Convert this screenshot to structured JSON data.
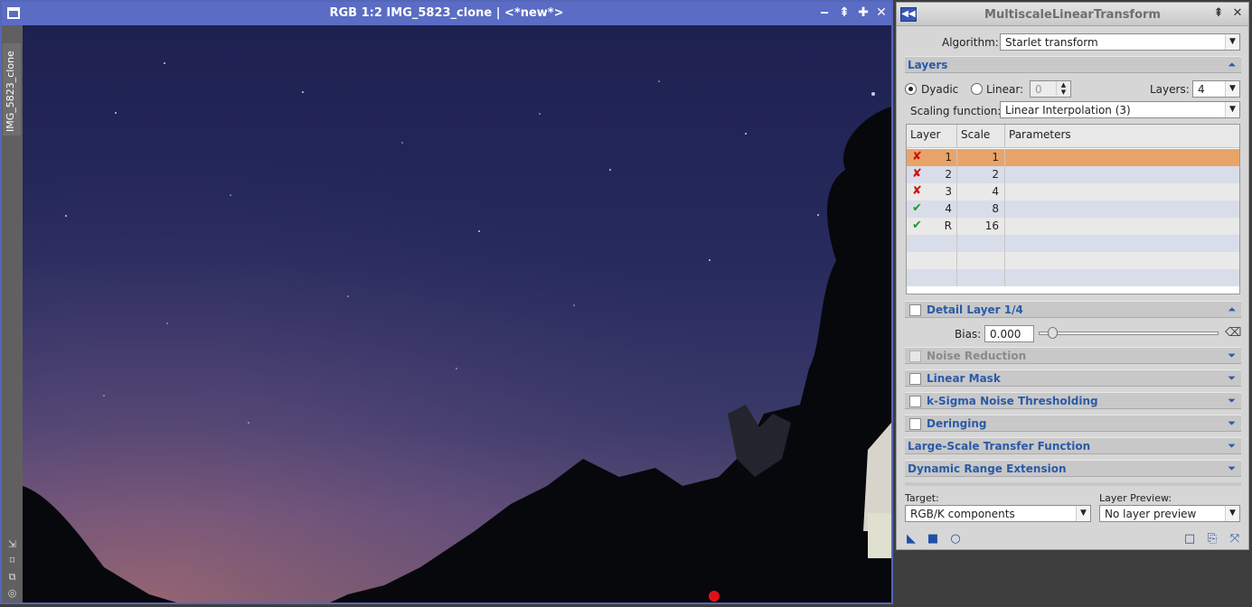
{
  "image_window": {
    "title": "RGB 1:2 IMG_5823_clone | <*new*>",
    "side_tab_label": "IMG_5823_clone",
    "controls": [
      "minimize-icon",
      "shade-icon",
      "maximize-icon",
      "close-icon"
    ]
  },
  "process": {
    "title": "MultiscaleLinearTransform",
    "algorithm_label": "Algorithm:",
    "algorithm_value": "Starlet transform",
    "layers_section": "Layers",
    "dyadic_label": "Dyadic",
    "linear_label": "Linear:",
    "linear_value": "0",
    "layers_label": "Layers:",
    "layers_value": "4",
    "scaling_label": "Scaling function:",
    "scaling_value": "Linear Interpolation (3)",
    "table": {
      "headers": [
        "Layer",
        "Scale",
        "Parameters"
      ],
      "rows": [
        {
          "enabled": false,
          "layer": "1",
          "scale": "1",
          "params": ""
        },
        {
          "enabled": false,
          "layer": "2",
          "scale": "2",
          "params": ""
        },
        {
          "enabled": false,
          "layer": "3",
          "scale": "4",
          "params": ""
        },
        {
          "enabled": true,
          "layer": "4",
          "scale": "8",
          "params": ""
        },
        {
          "enabled": true,
          "layer": "R",
          "scale": "16",
          "params": ""
        }
      ]
    },
    "detail_section": "Detail Layer 1/4",
    "bias_label": "Bias:",
    "bias_value": "0.000",
    "bias_fraction": 0.0,
    "sections": {
      "noise_reduction": "Noise Reduction",
      "linear_mask": "Linear Mask",
      "ksigma": "k-Sigma Noise Thresholding",
      "deringing": "Deringing",
      "large_scale": "Large-Scale Transfer Function",
      "dynamic_range": "Dynamic Range Extension"
    },
    "target_label": "Target:",
    "target_value": "RGB/K components",
    "layer_preview_label": "Layer Preview:",
    "layer_preview_value": "No layer preview"
  },
  "colors": {
    "image_window_title": "#5a6cc4",
    "section_label": "#2a5aa8",
    "selected_row": "#e8a468",
    "disabled_mark": "#cc1111",
    "enabled_mark": "#1f9a1f"
  }
}
